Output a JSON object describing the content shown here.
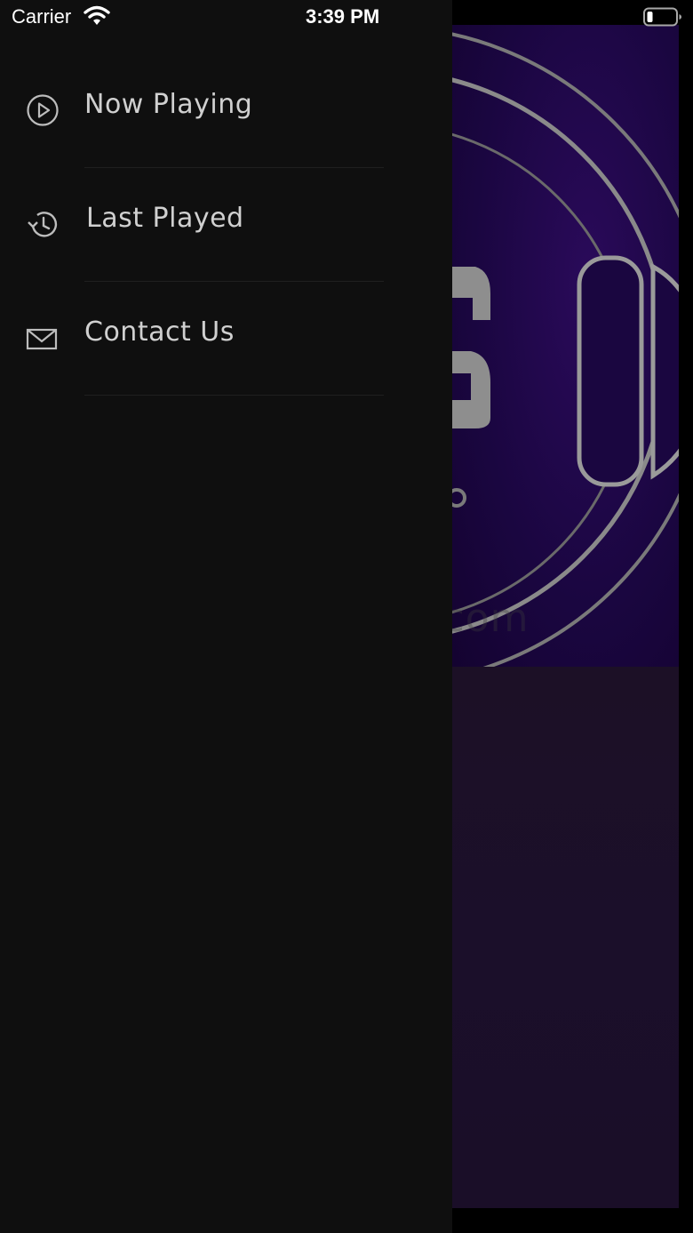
{
  "status_bar": {
    "carrier": "Carrier",
    "time": "3:39 PM",
    "wifi_icon": "wifi-icon",
    "battery_icon": "battery-icon"
  },
  "menu": {
    "items": [
      {
        "label": "Now Playing",
        "icon": "play-circle-icon"
      },
      {
        "label": "Last Played",
        "icon": "history-icon"
      },
      {
        "label": "Contact Us",
        "icon": "mail-icon"
      }
    ]
  },
  "watermark": "UpdateStar.com",
  "colors": {
    "drawer_bg": "#0f0f0f",
    "menu_text": "#d0d0d0",
    "artwork_bg": "#1a0640",
    "artwork_stroke": "#9a9a9a"
  }
}
